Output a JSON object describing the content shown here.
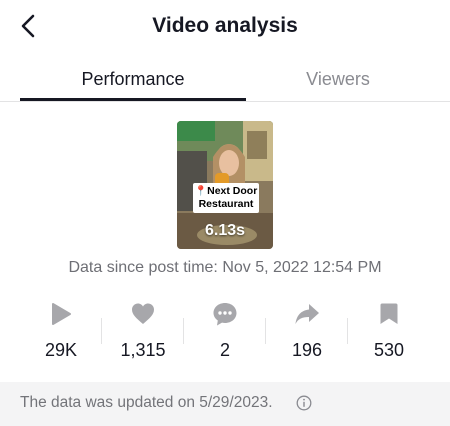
{
  "header": {
    "title": "Video analysis",
    "back_icon": "chevron-left-icon"
  },
  "tabs": [
    {
      "label": "Performance",
      "active": true
    },
    {
      "label": "Viewers",
      "active": false
    }
  ],
  "video": {
    "sticker_line1": "Next Door",
    "sticker_line2": "Restaurant",
    "duration": "6.13s"
  },
  "data_since": "Data since post time: Nov 5, 2022 12:54 PM",
  "stats": [
    {
      "icon": "play-icon",
      "value": "29K"
    },
    {
      "icon": "heart-icon",
      "value": "1,315"
    },
    {
      "icon": "comment-icon",
      "value": "2"
    },
    {
      "icon": "share-icon",
      "value": "196"
    },
    {
      "icon": "bookmark-icon",
      "value": "530"
    }
  ],
  "footer": {
    "text": "The data was updated on 5/29/2023.",
    "icon": "info-icon"
  },
  "colors": {
    "text_primary": "#161823",
    "text_secondary": "#8a8b91",
    "icon_gray": "#a7a7ab",
    "footer_bg": "#f4f4f5"
  }
}
